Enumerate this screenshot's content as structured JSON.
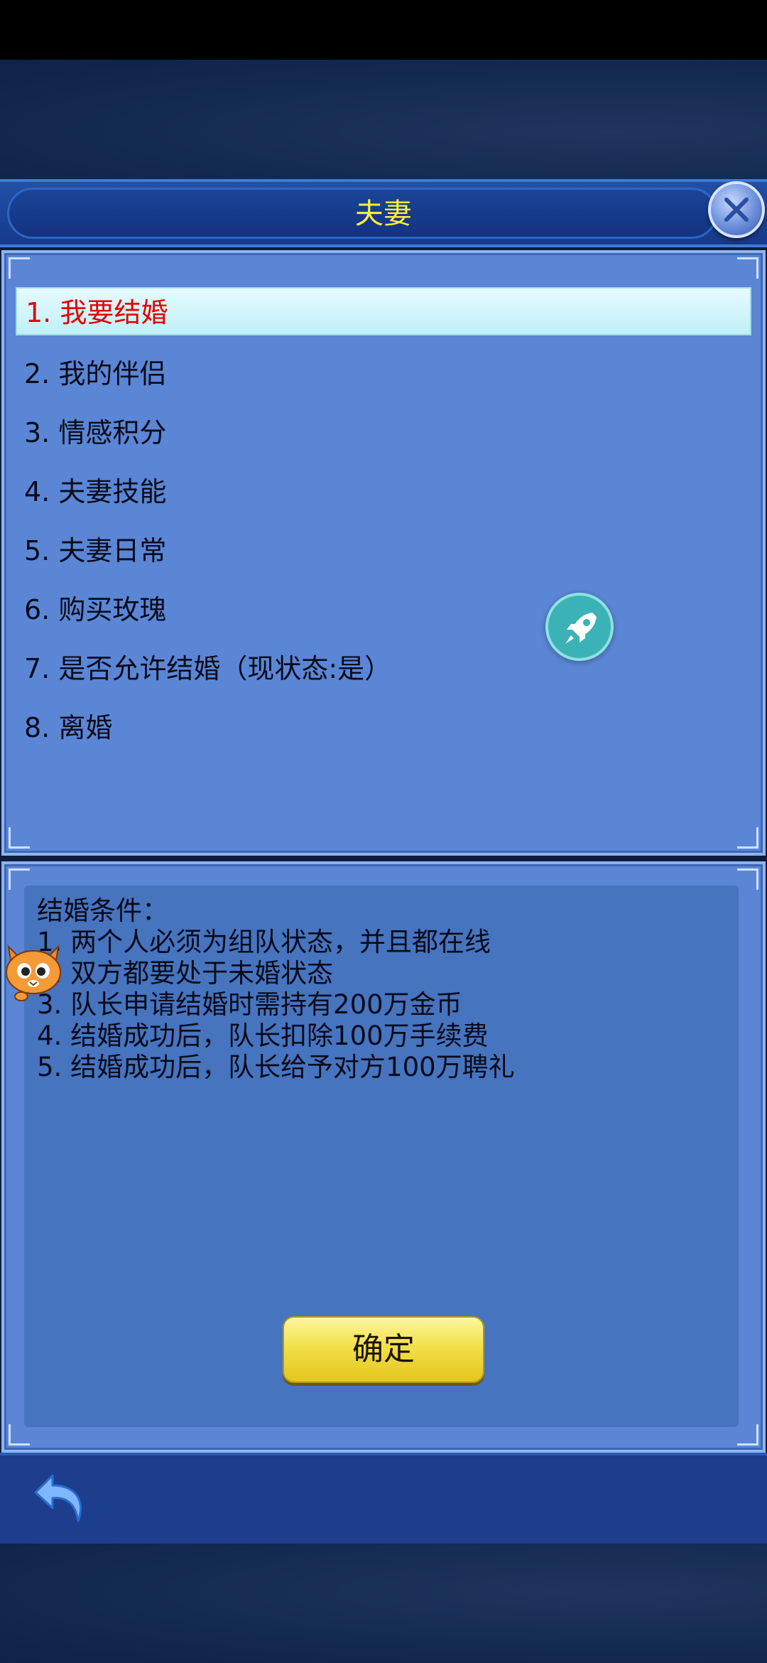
{
  "title": "夫妻",
  "menu": {
    "items": [
      {
        "label": "1. 我要结婚",
        "selected": true
      },
      {
        "label": "2. 我的伴侣",
        "selected": false
      },
      {
        "label": "3. 情感积分",
        "selected": false
      },
      {
        "label": "4. 夫妻技能",
        "selected": false
      },
      {
        "label": "5. 夫妻日常",
        "selected": false
      },
      {
        "label": "6. 购买玫瑰",
        "selected": false
      },
      {
        "label": "7. 是否允许结婚（现状态:是）",
        "selected": false
      },
      {
        "label": "8. 离婚",
        "selected": false
      }
    ]
  },
  "description": {
    "heading": "结婚条件：",
    "lines": [
      "1. 两个人必须为组队状态，并且都在线",
      "2. 双方都要处于未婚状态",
      "3. 队长申请结婚时需持有200万金币",
      "4. 结婚成功后，队长扣除100万手续费",
      "5. 结婚成功后，队长给予对方100万聘礼"
    ]
  },
  "confirm_label": "确定",
  "icons": {
    "close": "close-icon",
    "rocket": "rocket-icon",
    "back": "back-arrow-icon",
    "mascot": "cat-mascot-icon"
  },
  "colors": {
    "title_text": "#ffee3a",
    "selected_text": "#e60000",
    "panel_bg": "#5a86d5",
    "confirm_button": "#f3e04a"
  }
}
